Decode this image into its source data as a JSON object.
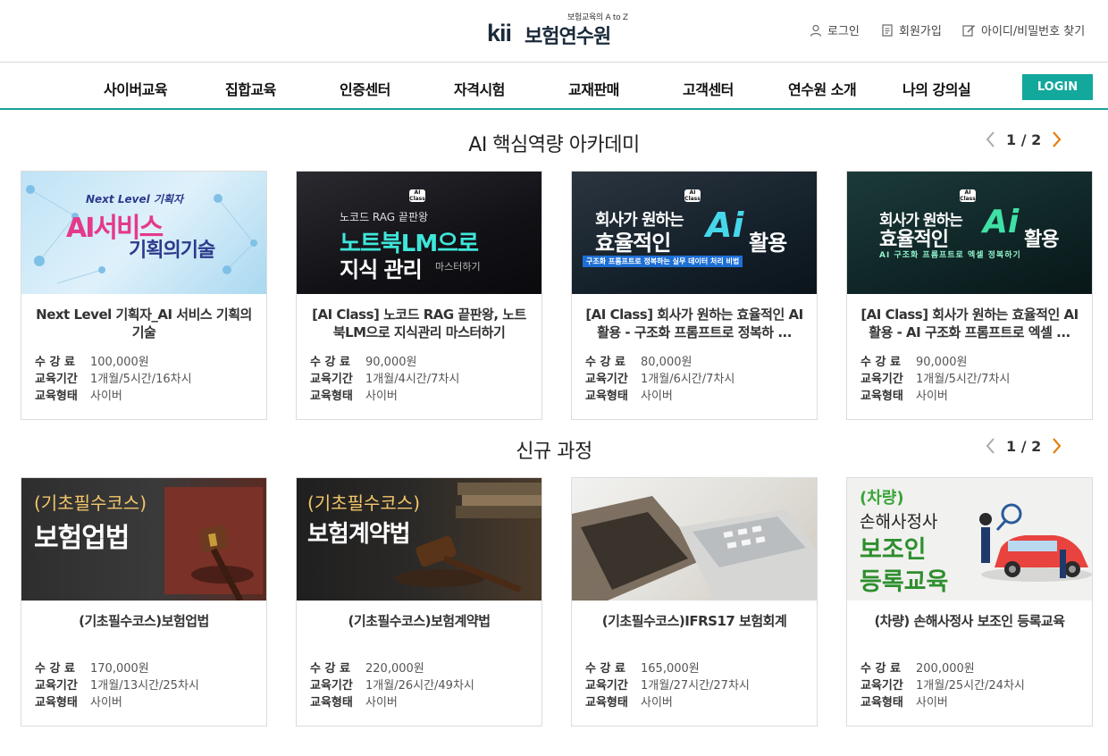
{
  "header": {
    "logo_tagline": "보험교육의 A to Z",
    "logo_mark": "kii",
    "logo_name": "보험연수원",
    "util": {
      "login": "로그인",
      "join": "회원가입",
      "find": "아이디/비밀번호 찾기"
    }
  },
  "nav": {
    "items": [
      "사이버교육",
      "집합교육",
      "인증센터",
      "자격시험",
      "교재판매",
      "고객센터",
      "연수원 소개",
      "나의 강의실"
    ],
    "login_button": "LOGIN"
  },
  "meta_labels": {
    "fee": "수 강 료",
    "period": "교육기간",
    "type": "교육형태"
  },
  "sections": [
    {
      "title": "AI 핵심역량 아카데미",
      "pager": "1 / 2",
      "cards": [
        {
          "title": "Next Level 기획자_AI 서비스 기획의 기술",
          "fee": "100,000원",
          "period": "1개월/5시간/16차시",
          "type": "사이버",
          "thumb": {
            "line1": "Next Level 기획자",
            "line2": "AI서비스",
            "line3": "기획의기술"
          }
        },
        {
          "title": "[AI Class] 노코드 RAG 끝판왕, 노트북LM으로 지식관리 마스터하기",
          "fee": "90,000원",
          "period": "1개월/4시간/7차시",
          "type": "사이버",
          "thumb": {
            "badge": "AI Class",
            "line1": "노코드 RAG 끝판왕",
            "line2": "노트북LM으로",
            "line3": "지식 관리",
            "line4": "마스터하기"
          }
        },
        {
          "title": "[AI Class] 회사가 원하는 효율적인 AI 활용 - 구조화 프롬프트로 정복하 ...",
          "fee": "80,000원",
          "period": "1개월/6시간/7차시",
          "type": "사이버",
          "thumb": {
            "badge": "AI Class",
            "line1": "회사가 원하는",
            "line2": "효율적인",
            "line3": "활용",
            "line4": "구조화 프롬프트로 정복하는 실무 데이터 처리 비법"
          }
        },
        {
          "title": "[AI Class] 회사가 원하는 효율적인 AI활용 - AI 구조화 프롬프트로 엑셀 ...",
          "fee": "90,000원",
          "period": "1개월/5시간/7차시",
          "type": "사이버",
          "thumb": {
            "badge": "AI Class",
            "line1": "회사가 원하는",
            "line2": "효율적인",
            "line3": "활용",
            "line4": "AI 구조화 프롬프트로 엑셀 정복하기"
          }
        }
      ]
    },
    {
      "title": "신규 과정",
      "pager": "1 / 2",
      "cards": [
        {
          "title": "(기초필수코스)보험업법",
          "fee": "170,000원",
          "period": "1개월/13시간/25차시",
          "type": "사이버",
          "thumb": {
            "line1": "(기초필수코스)",
            "line2": "보험업법"
          }
        },
        {
          "title": "(기초필수코스)보험계약법",
          "fee": "220,000원",
          "period": "1개월/26시간/49차시",
          "type": "사이버",
          "thumb": {
            "line1": "(기초필수코스)",
            "line2": "보험계약법"
          }
        },
        {
          "title": "(기초필수코스)IFRS17 보험회계",
          "fee": "165,000원",
          "period": "1개월/27시간/27차시",
          "type": "사이버",
          "thumb": {}
        },
        {
          "title": "(차량) 손해사정사 보조인 등록교육",
          "fee": "200,000원",
          "period": "1개월/25시간/24차시",
          "type": "사이버",
          "thumb": {
            "line1": "(차량)",
            "line2": "손해사정사",
            "line3": "보조인",
            "line4": "등록교육"
          }
        }
      ]
    }
  ]
}
